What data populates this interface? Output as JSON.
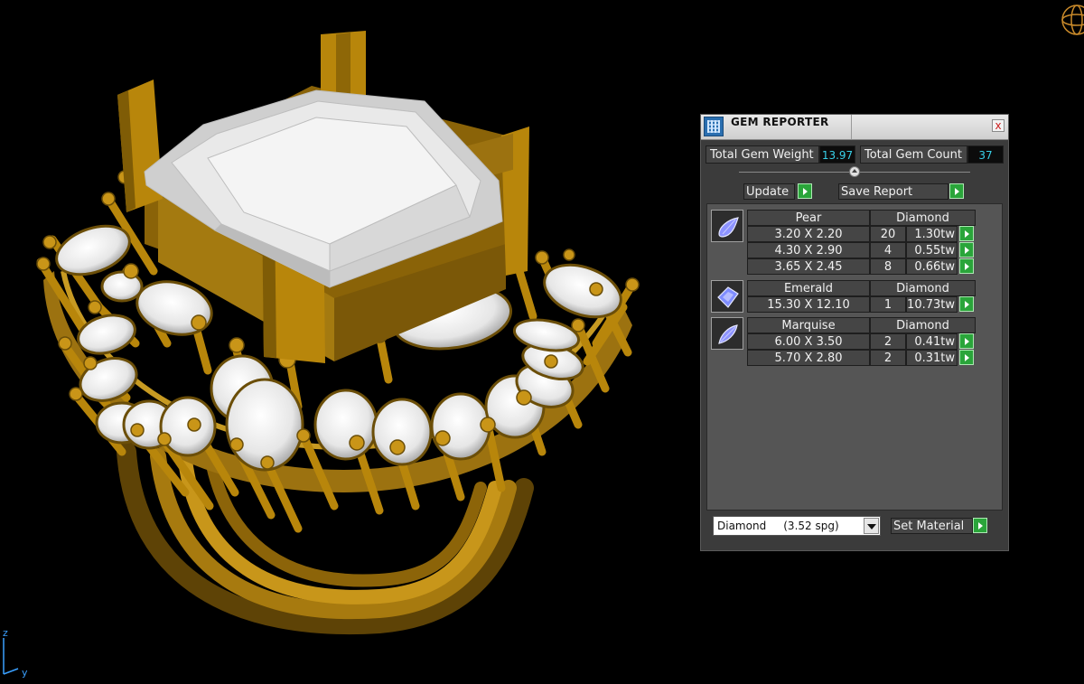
{
  "viewport": {
    "axis_z": "z",
    "axis_y": "y",
    "metal_color": "#b8860b",
    "gem_color": "#f2f2f2",
    "background": "#000000"
  },
  "panel": {
    "title": "GEM REPORTER",
    "close_glyph": "x",
    "total_weight_label": "Total Gem Weight",
    "total_weight_value": "13.97",
    "total_count_label": "Total Gem Count",
    "total_count_value": "37",
    "update_label": "Update",
    "save_report_label": "Save Report",
    "gems": [
      {
        "shape": "Pear",
        "material": "Diamond",
        "icon": "pear-gem-icon",
        "rows": [
          {
            "size": "3.20 X 2.20",
            "count": "20",
            "weight": "1.30tw"
          },
          {
            "size": "4.30 X 2.90",
            "count": "4",
            "weight": "0.55tw"
          },
          {
            "size": "3.65 X 2.45",
            "count": "8",
            "weight": "0.66tw"
          }
        ]
      },
      {
        "shape": "Emerald",
        "material": "Diamond",
        "icon": "emerald-gem-icon",
        "rows": [
          {
            "size": "15.30 X 12.10",
            "count": "1",
            "weight": "10.73tw"
          }
        ]
      },
      {
        "shape": "Marquise",
        "material": "Diamond",
        "icon": "marquise-gem-icon",
        "rows": [
          {
            "size": "6.00 X 3.50",
            "count": "2",
            "weight": "0.41tw"
          },
          {
            "size": "5.70 X 2.80",
            "count": "2",
            "weight": "0.31tw"
          }
        ]
      }
    ],
    "material_select_value": "Diamond     (3.52 spg)",
    "set_material_label": "Set Material"
  }
}
